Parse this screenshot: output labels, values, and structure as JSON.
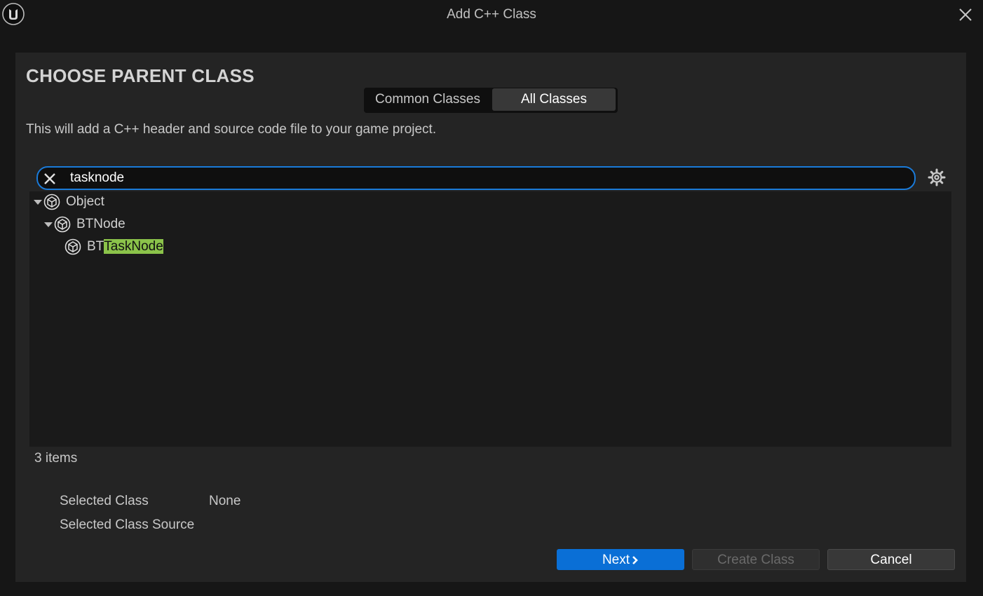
{
  "window": {
    "title": "Add C++ Class"
  },
  "heading": "CHOOSE PARENT CLASS",
  "tabs": [
    {
      "label": "Common Classes",
      "selected": false
    },
    {
      "label": "All Classes",
      "selected": true
    }
  ],
  "description": "This will add a C++ header and source code file to your game project.",
  "search": {
    "value": "tasknode"
  },
  "tree": [
    {
      "label": "Object",
      "expanded": true,
      "depth": 0
    },
    {
      "label": "BTNode",
      "expanded": true,
      "depth": 1
    },
    {
      "label_prefix": "BT",
      "label_match": "TaskNode",
      "depth": 2
    }
  ],
  "item_count": "3 items",
  "selected_class": {
    "label": "Selected Class",
    "value": "None"
  },
  "selected_class_source": {
    "label": "Selected Class Source",
    "value": ""
  },
  "buttons": {
    "next": "Next",
    "create": "Create Class",
    "cancel": "Cancel"
  },
  "icons": {
    "logo": "unreal-logo-icon",
    "close": "close-icon",
    "clear": "clear-search-icon",
    "settings": "gear-icon",
    "class": "class-cube-icon",
    "expand": "triangle-down-icon",
    "next": "chevron-right-icon"
  },
  "colors": {
    "accent": "#0a6fd6",
    "highlight": "#8bc34a",
    "panel": "#242424",
    "background": "#161616"
  }
}
